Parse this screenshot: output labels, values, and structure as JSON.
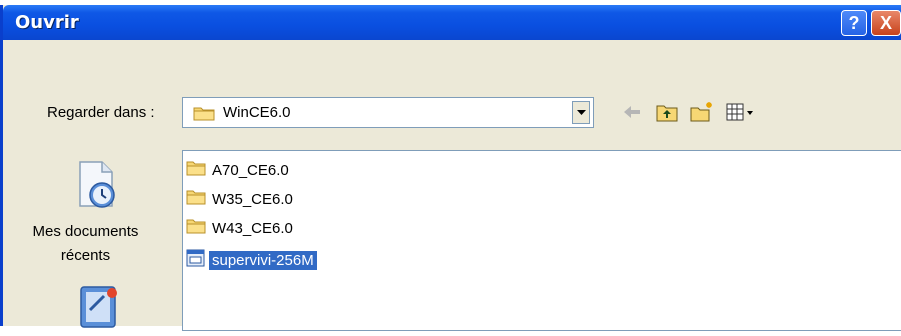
{
  "dialog": {
    "title": "Ouvrir",
    "help_button": "?",
    "close_button": "X"
  },
  "lookin": {
    "label": "Regarder dans :",
    "value": "WinCE6.0"
  },
  "toolbar": {
    "icons": [
      "back-arrow-icon",
      "up-one-level-icon",
      "new-folder-icon",
      "view-menu-icon"
    ]
  },
  "places": [
    {
      "label_line1": "Mes documents",
      "label_line2": "récents",
      "icon": "recent-documents-icon"
    },
    {
      "icon": "desktop-icon"
    }
  ],
  "files": [
    {
      "name": "A70_CE6.0",
      "type": "folder",
      "selected": false
    },
    {
      "name": "W35_CE6.0",
      "type": "folder",
      "selected": false
    },
    {
      "name": "W43_CE6.0",
      "type": "folder",
      "selected": false
    },
    {
      "name": "supervivi-256M",
      "type": "file",
      "selected": true
    }
  ],
  "colors": {
    "titlebar": "#0a4fe0",
    "selection": "#316ac5",
    "dialog_bg": "#ece9d8"
  }
}
